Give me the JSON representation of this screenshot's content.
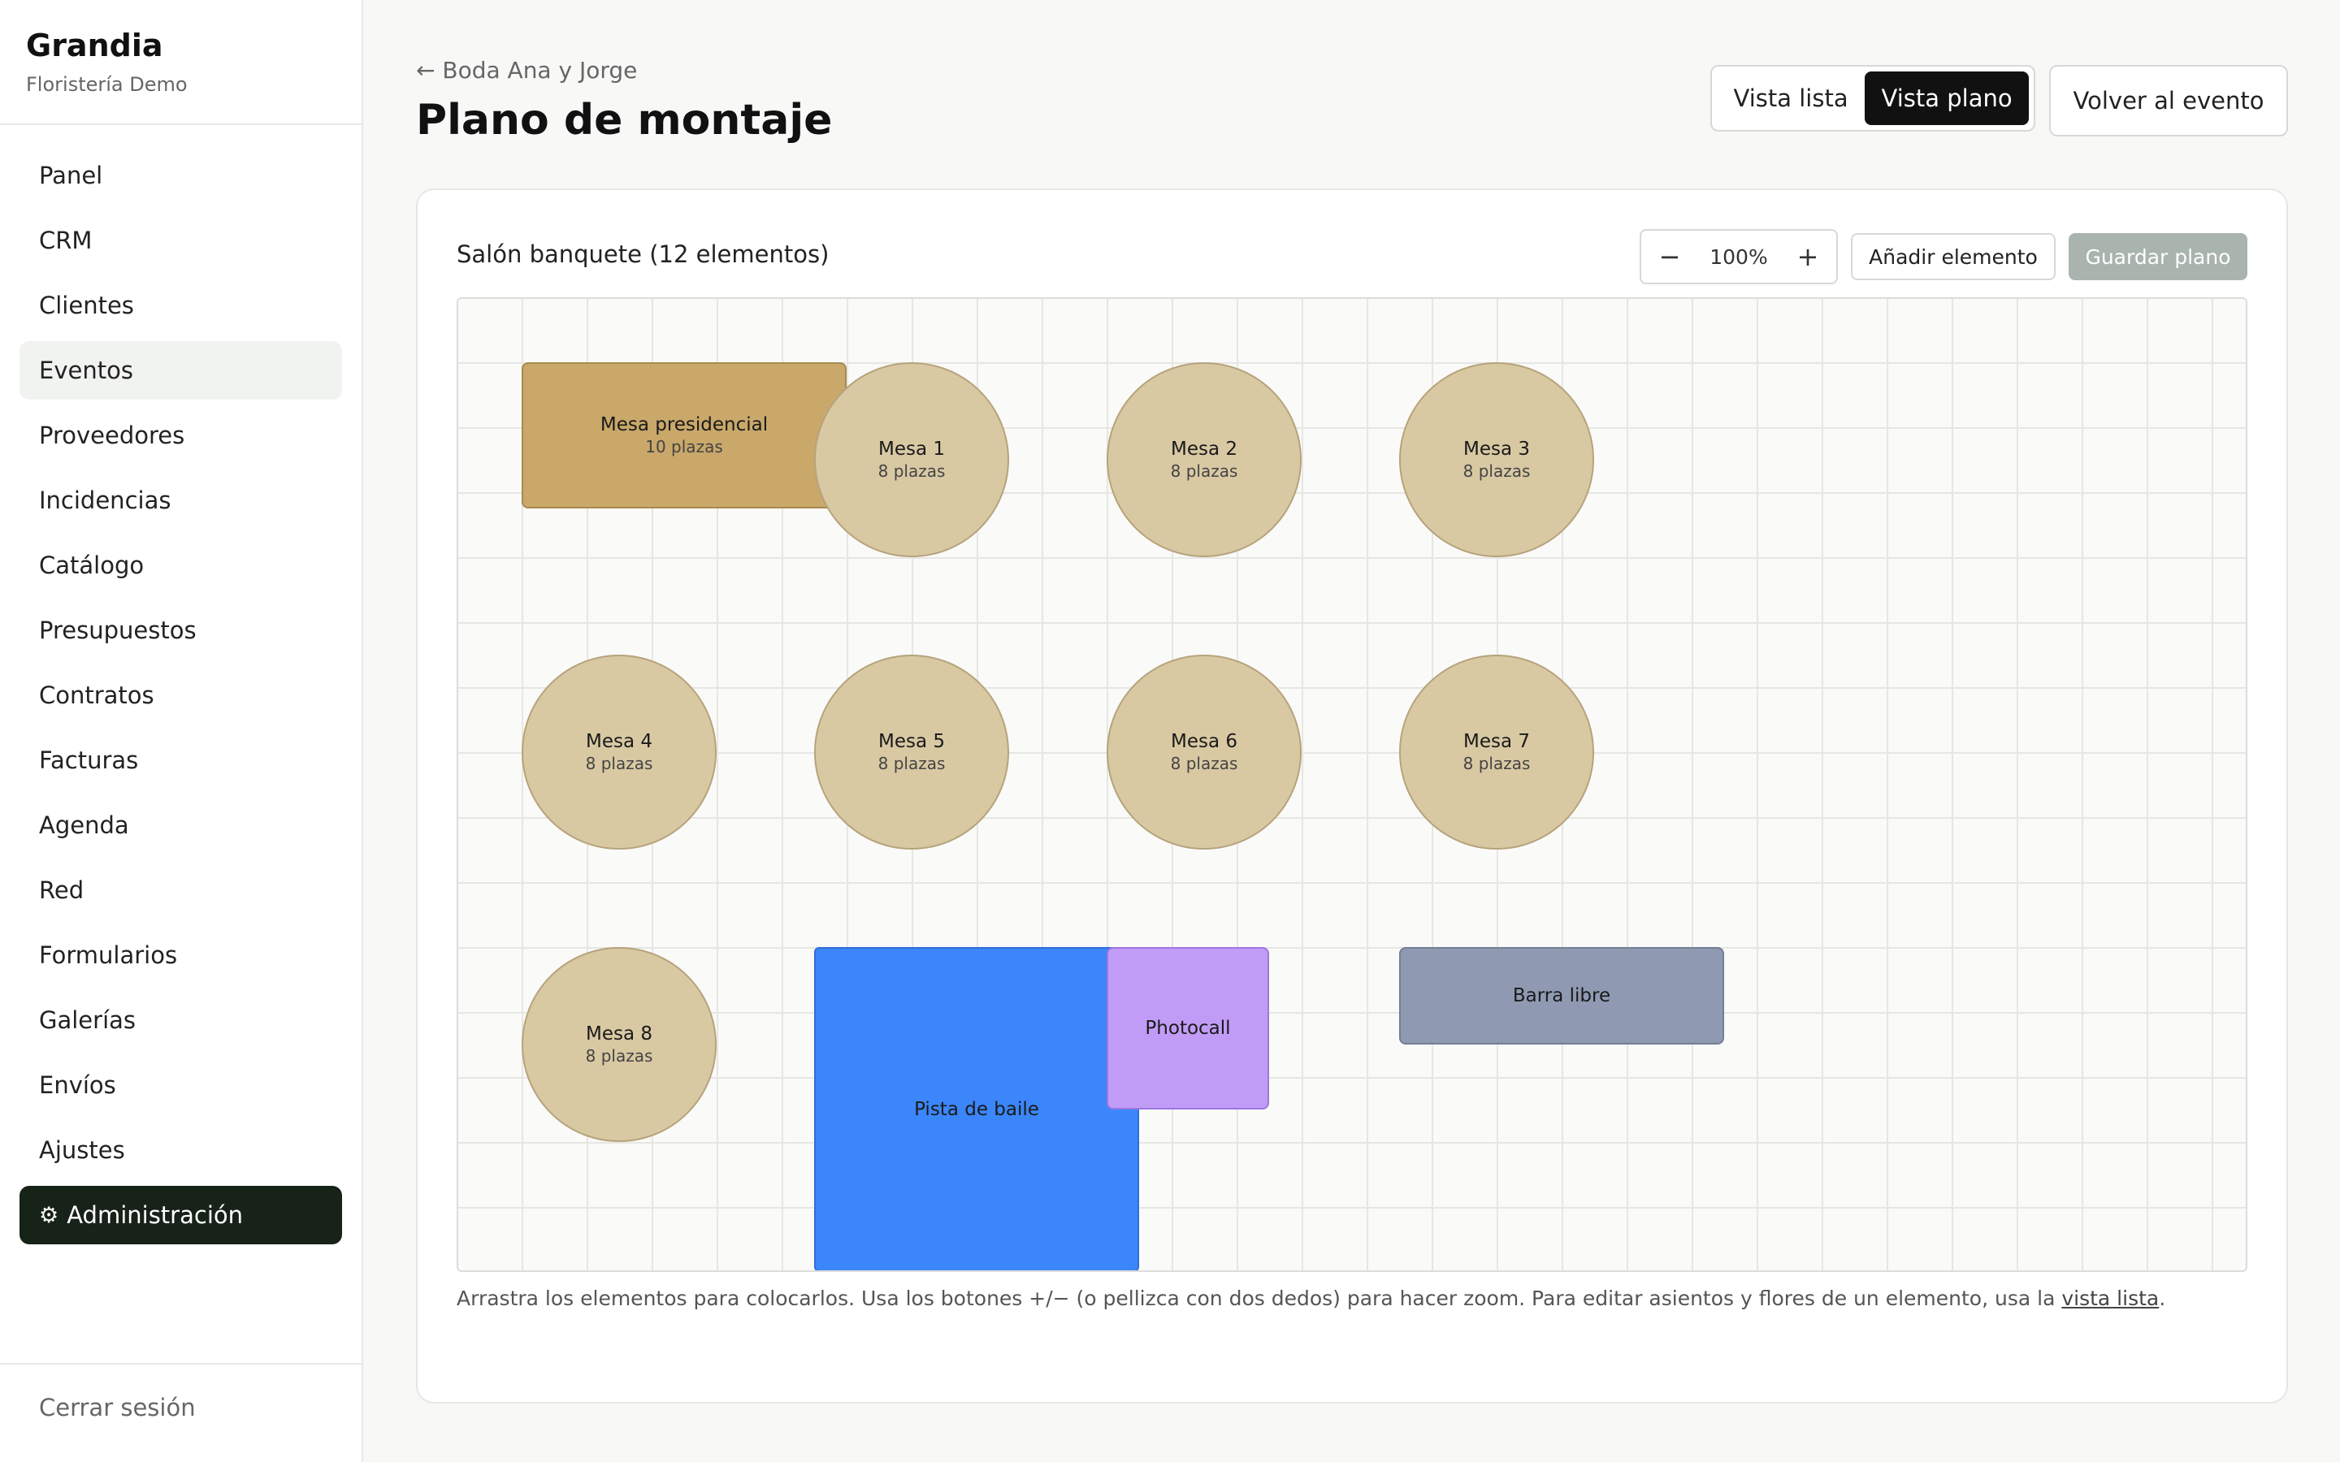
{
  "sidebar": {
    "brand": "Grandia",
    "subtitle": "Floristería Demo",
    "items": [
      {
        "label": "Panel"
      },
      {
        "label": "CRM"
      },
      {
        "label": "Clientes"
      },
      {
        "label": "Eventos",
        "active": true
      },
      {
        "label": "Proveedores"
      },
      {
        "label": "Incidencias"
      },
      {
        "label": "Catálogo"
      },
      {
        "label": "Presupuestos"
      },
      {
        "label": "Contratos"
      },
      {
        "label": "Facturas"
      },
      {
        "label": "Agenda"
      },
      {
        "label": "Red"
      },
      {
        "label": "Formularios"
      },
      {
        "label": "Galerías"
      },
      {
        "label": "Envíos"
      },
      {
        "label": "Ajustes"
      }
    ],
    "admin_icon": "⚙",
    "admin_label": "Administración",
    "logout": "Cerrar sesión"
  },
  "header": {
    "back_link": "← Boda Ana y Jorge",
    "title": "Plano de montaje",
    "view_list": "Vista lista",
    "view_plan": "Vista plano",
    "back_event": "Volver al evento"
  },
  "toolbar": {
    "room_title": "Salón banquete (12 elementos)",
    "zoom_out": "−",
    "zoom_value": "100%",
    "zoom_in": "+",
    "add_element": "Añadir elemento",
    "save_plan": "Guardar plano"
  },
  "elements": {
    "presidencial": {
      "name": "Mesa presidencial",
      "seats": "10 plazas"
    },
    "mesa1": {
      "name": "Mesa 1",
      "seats": "8 plazas"
    },
    "mesa2": {
      "name": "Mesa 2",
      "seats": "8 plazas"
    },
    "mesa3": {
      "name": "Mesa 3",
      "seats": "8 plazas"
    },
    "mesa4": {
      "name": "Mesa 4",
      "seats": "8 plazas"
    },
    "mesa5": {
      "name": "Mesa 5",
      "seats": "8 plazas"
    },
    "mesa6": {
      "name": "Mesa 6",
      "seats": "8 plazas"
    },
    "mesa7": {
      "name": "Mesa 7",
      "seats": "8 plazas"
    },
    "mesa8": {
      "name": "Mesa 8",
      "seats": "8 plazas"
    },
    "pista": {
      "name": "Pista de baile"
    },
    "photocall": {
      "name": "Photocall"
    },
    "barra": {
      "name": "Barra libre"
    }
  },
  "hint": {
    "text": "Arrastra los elementos para colocarlos. Usa los botones +/− (o pellizca con dos dedos) para hacer zoom. Para editar asientos y flores de un elemento, usa la ",
    "link": "vista lista",
    "end": "."
  },
  "colors": {
    "round_table": "#d9c9a3",
    "presidential_table": "#c9a86a",
    "dance_floor": "#3b86fb",
    "photocall": "#c19cf7",
    "bar": "#8f9ab2",
    "admin_bg": "#172218"
  }
}
